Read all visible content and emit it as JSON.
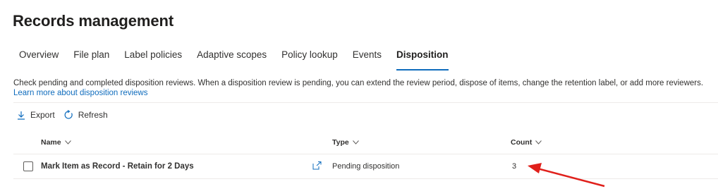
{
  "page": {
    "title": "Records management"
  },
  "tabs": [
    {
      "label": "Overview"
    },
    {
      "label": "File plan"
    },
    {
      "label": "Label policies"
    },
    {
      "label": "Adaptive scopes"
    },
    {
      "label": "Policy lookup"
    },
    {
      "label": "Events"
    },
    {
      "label": "Disposition",
      "active": true
    }
  ],
  "description": {
    "text": "Check pending and completed disposition reviews. When a disposition review is pending, you can extend the review period, dispose of items, change the retention label, or add more reviewers.",
    "link": "Learn more about disposition reviews"
  },
  "toolbar": {
    "export_label": "Export",
    "export_icon": "download-icon",
    "refresh_label": "Refresh",
    "refresh_icon": "refresh-icon"
  },
  "table": {
    "columns": [
      {
        "label": "Name"
      },
      {
        "label": "Type"
      },
      {
        "label": "Count"
      }
    ],
    "rows": [
      {
        "name": "Mark Item as Record - Retain for 2 Days",
        "type": "Pending disposition",
        "count": "3"
      }
    ]
  },
  "colors": {
    "accent": "#0f6cbd",
    "annotation_arrow": "#e0201b"
  }
}
